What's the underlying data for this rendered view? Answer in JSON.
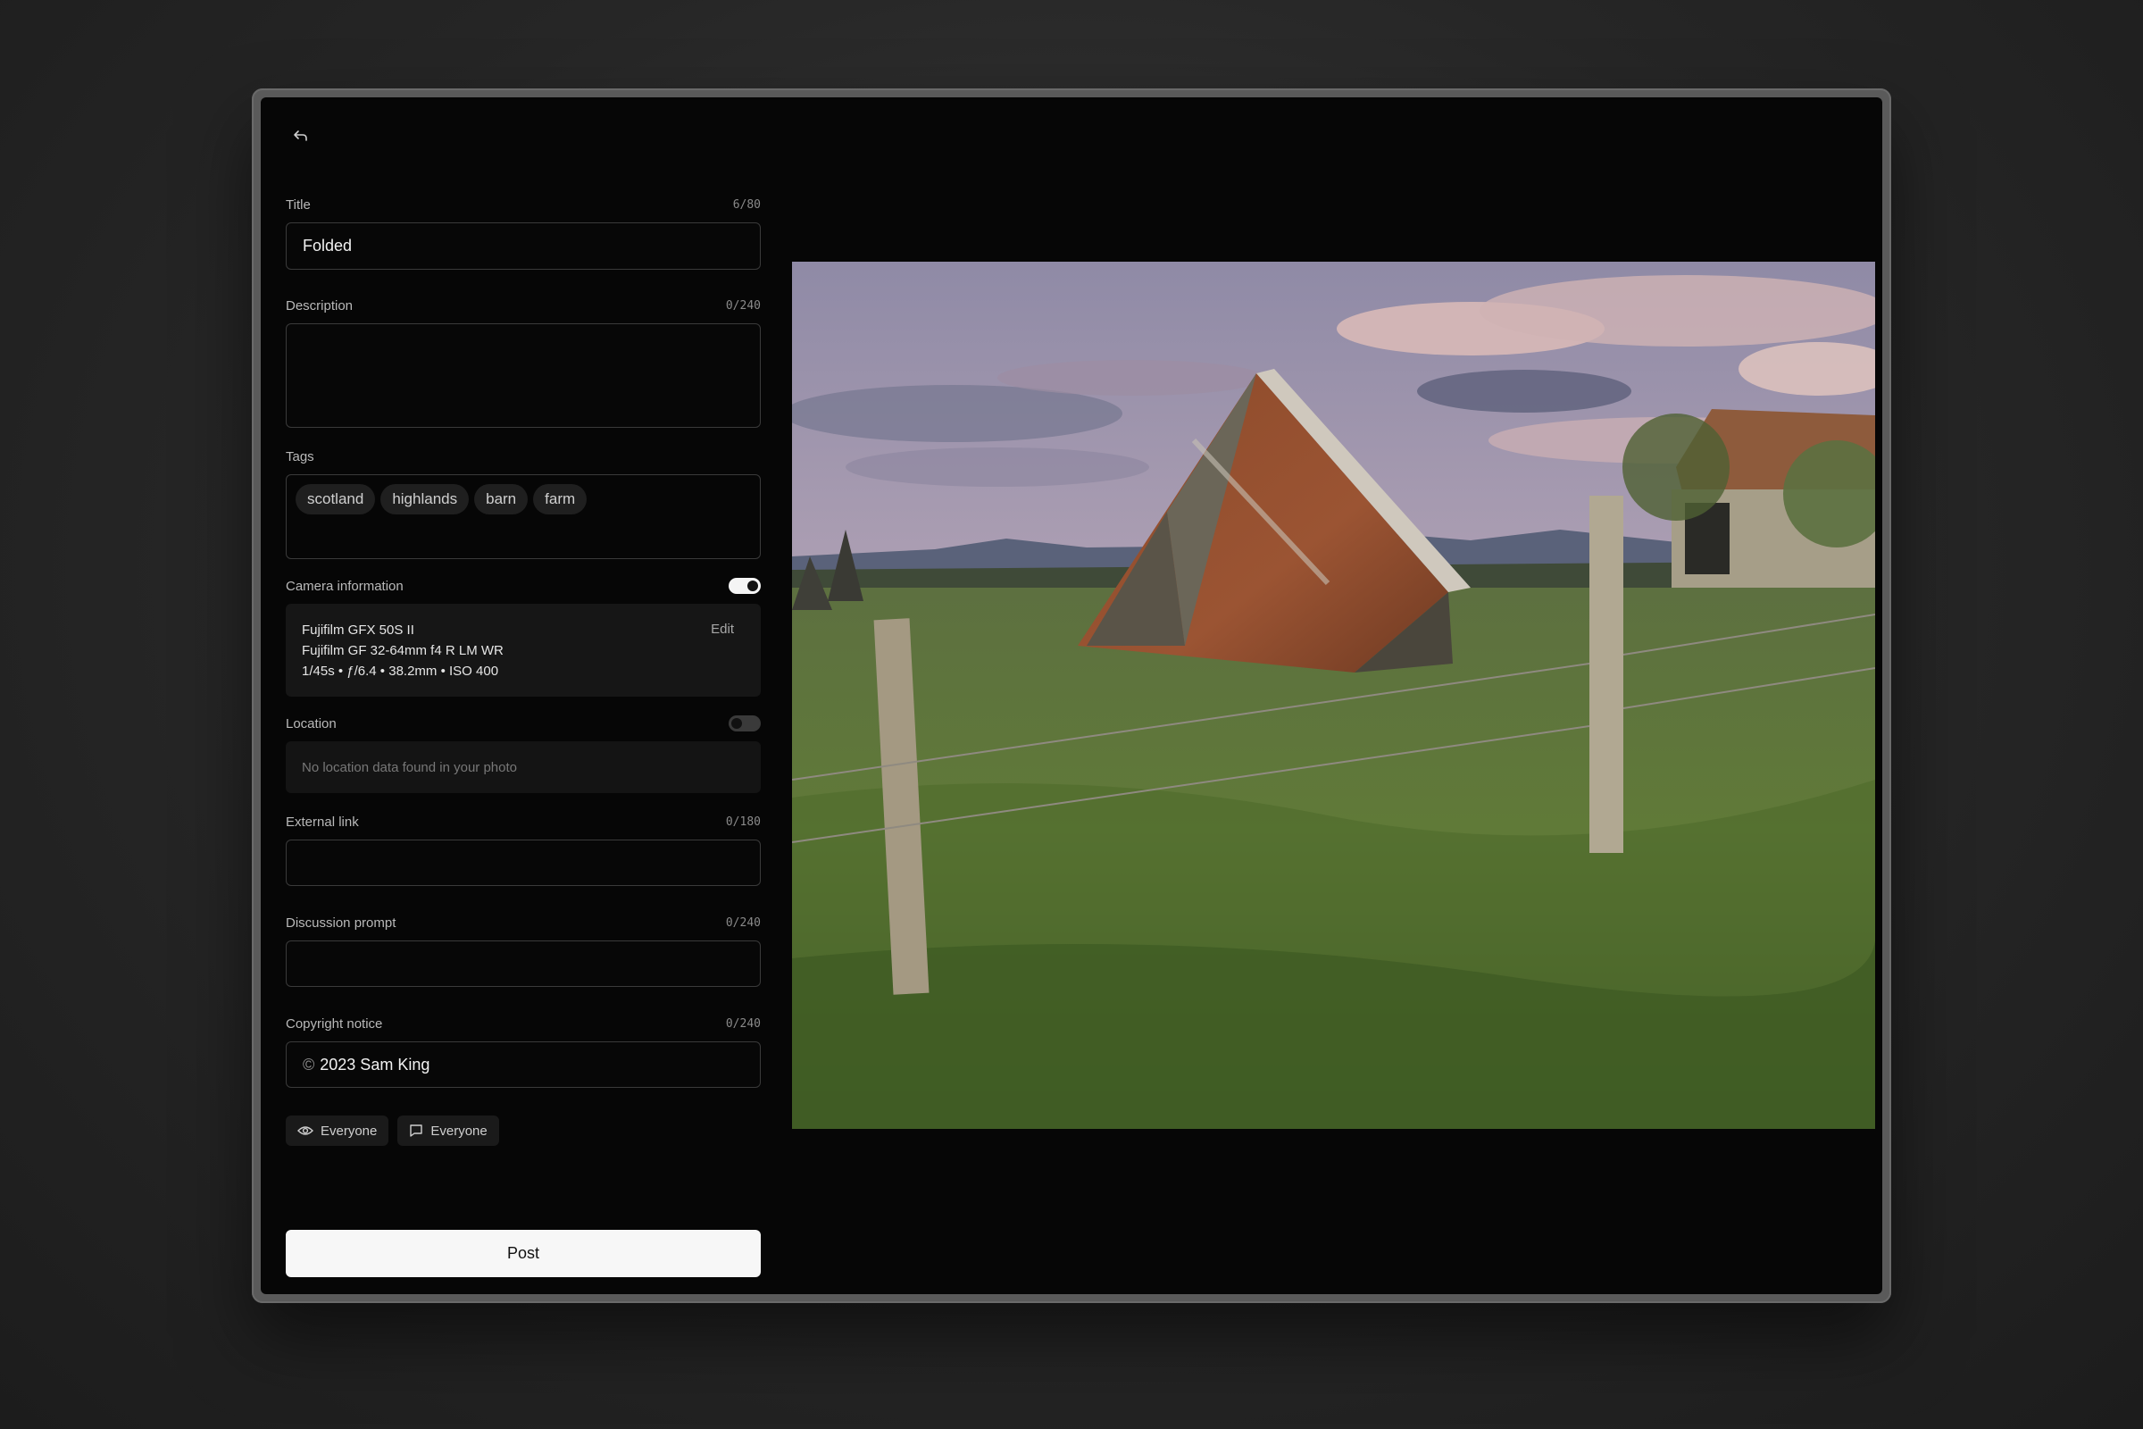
{
  "form": {
    "title": {
      "label": "Title",
      "counter": "6/80",
      "value": "Folded"
    },
    "description": {
      "label": "Description",
      "counter": "0/240",
      "value": ""
    },
    "tags": {
      "label": "Tags",
      "items": [
        "scotland",
        "highlands",
        "barn",
        "farm"
      ]
    },
    "camera": {
      "label": "Camera information",
      "enabled": true,
      "body": "Fujifilm GFX 50S II",
      "lens": "Fujifilm GF 32-64mm f4 R LM WR",
      "settings": "1/45s • ƒ/6.4 • 38.2mm • ISO 400",
      "edit_label": "Edit"
    },
    "location": {
      "label": "Location",
      "enabled": false,
      "message": "No location data found in your photo"
    },
    "external_link": {
      "label": "External link",
      "counter": "0/180",
      "value": ""
    },
    "discussion_prompt": {
      "label": "Discussion prompt",
      "counter": "0/240",
      "value": ""
    },
    "copyright": {
      "label": "Copyright notice",
      "counter": "0/240",
      "symbol": "©",
      "value": "2023 Sam King"
    },
    "visibility": {
      "view_label": "Everyone",
      "comment_label": "Everyone"
    },
    "post_label": "Post"
  },
  "icons": {
    "back": "undo-arrow-icon",
    "view": "eye-icon",
    "comment": "comment-icon"
  }
}
